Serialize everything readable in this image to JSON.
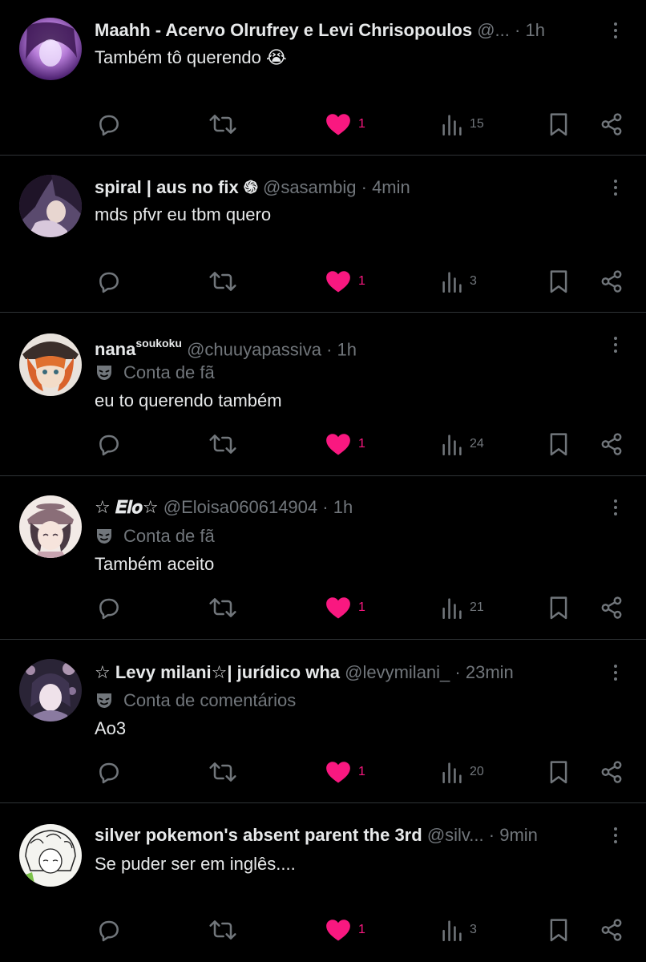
{
  "colors": {
    "background": "#000000",
    "text": "#e7e9ea",
    "secondary": "#71767b",
    "like": "#f91880",
    "divider": "#2f3336"
  },
  "tweets": [
    {
      "name": "Maahh - Acervo Olrufrey e Levi Chrisopoulos",
      "name_sup": "",
      "handle": "@...",
      "sep": "·",
      "time": "1h",
      "badge": "",
      "text": "Também tô querendo 😭",
      "likes": "1",
      "views": "15"
    },
    {
      "name": "spiral | aus no fix ֍",
      "name_sup": "",
      "handle": "@sasambig",
      "sep": "·",
      "time": "4min",
      "badge": "",
      "text": "mds pfvr eu tbm quero",
      "likes": "1",
      "views": "3"
    },
    {
      "name": "nana",
      "name_sup": "soukoku",
      "handle": "@chuuyapassiva",
      "sep": "·",
      "time": "1h",
      "badge": "Conta de fã",
      "text": "eu to querendo também",
      "likes": "1",
      "views": "24"
    },
    {
      "name": "☆ 𝑬𝒍𝒐☆",
      "name_sup": "",
      "handle": "@Eloisa060614904",
      "sep": "·",
      "time": "1h",
      "badge": "Conta de fã",
      "text": "Também aceito",
      "likes": "1",
      "views": "21"
    },
    {
      "name": "☆ Levy milani☆| jurídico wha",
      "name_sup": "",
      "handle": "@levymilani_",
      "sep": "·",
      "time": "23min",
      "badge": "Conta de comentários",
      "text": "Ao3",
      "likes": "1",
      "views": "20"
    },
    {
      "name": "silver pokemon's absent parent the 3rd",
      "name_sup": "",
      "handle": "@silv...",
      "sep": "·",
      "time": "9min",
      "badge": "",
      "text": "Se puder ser em inglês....",
      "likes": "1",
      "views": "3"
    }
  ]
}
